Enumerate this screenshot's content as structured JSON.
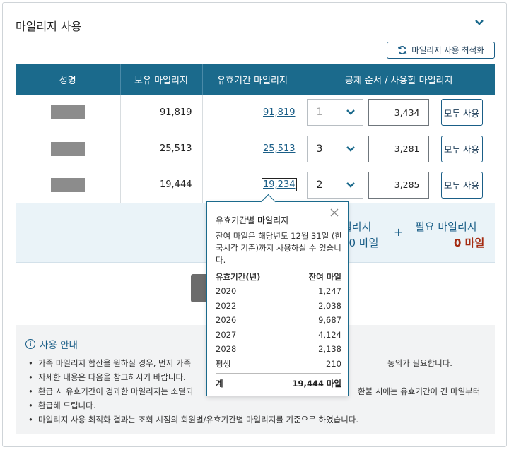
{
  "header": {
    "title": "마일리지 사용"
  },
  "toolbar": {
    "optimize_label": "마일리지 사용 최적화"
  },
  "table": {
    "columns": [
      "성명",
      "보유 마일리지",
      "유효기간 마일리지",
      "공제 순서 / 사용할 마일리지"
    ],
    "rows": [
      {
        "held": "91,819",
        "valid": "91,819",
        "order": "1",
        "use": "3,434",
        "button": "모두 사용"
      },
      {
        "held": "25,513",
        "valid": "25,513",
        "order": "3",
        "use": "3,281",
        "button": "모두 사용"
      },
      {
        "held": "19,444",
        "valid": "19,234",
        "order": "2",
        "use": "3,285",
        "button": "모두 사용"
      }
    ]
  },
  "summary": {
    "label_1": "일리지",
    "value_1": "00 마일",
    "plus": "+",
    "label_2": "필요 마일리지",
    "value_2": "0 마일"
  },
  "guide": {
    "title": "사용 안내",
    "items": [
      "가족 마일리지 합산을 원하실 경우, 먼저 가족",
      "자세한 내용은 다음을 참고하시기 바랍니다.",
      "환급 시 유효기간이 경과한 마일리지는 소멸되",
      "환급해 드립니다.",
      "마일리지 사용 최적화 결과는 조회 시점의 회원별/유효기간별 마일리지를 기준으로 하였습니다."
    ],
    "item_tail_1": "동의가 필요합니다.",
    "item_tail_3": "환불 시에는 유효기간이 긴 마일부터"
  },
  "popover": {
    "title": "유효기간별 마일리지",
    "description": "잔여 마일은 해당년도 12월 31일 (한국시각 기준)까지 사용하실 수 있습니다.",
    "col_year": "유효기간(년)",
    "col_remaining": "잔여 마일",
    "rows": [
      {
        "year": "2020",
        "miles": "1,247"
      },
      {
        "year": "2022",
        "miles": "2,038"
      },
      {
        "year": "2026",
        "miles": "9,687"
      },
      {
        "year": "2027",
        "miles": "4,124"
      },
      {
        "year": "2028",
        "miles": "2,138"
      },
      {
        "year": "평생",
        "miles": "210"
      }
    ],
    "total_label": "계",
    "total_value": "19,444 마일"
  },
  "colors": {
    "header_bg": "#1b6a8c",
    "accent": "#1a5e87",
    "required_value": "#a42b12"
  },
  "icons": [
    "chevron-down-icon",
    "refresh-icon",
    "close-icon",
    "info-icon"
  ]
}
